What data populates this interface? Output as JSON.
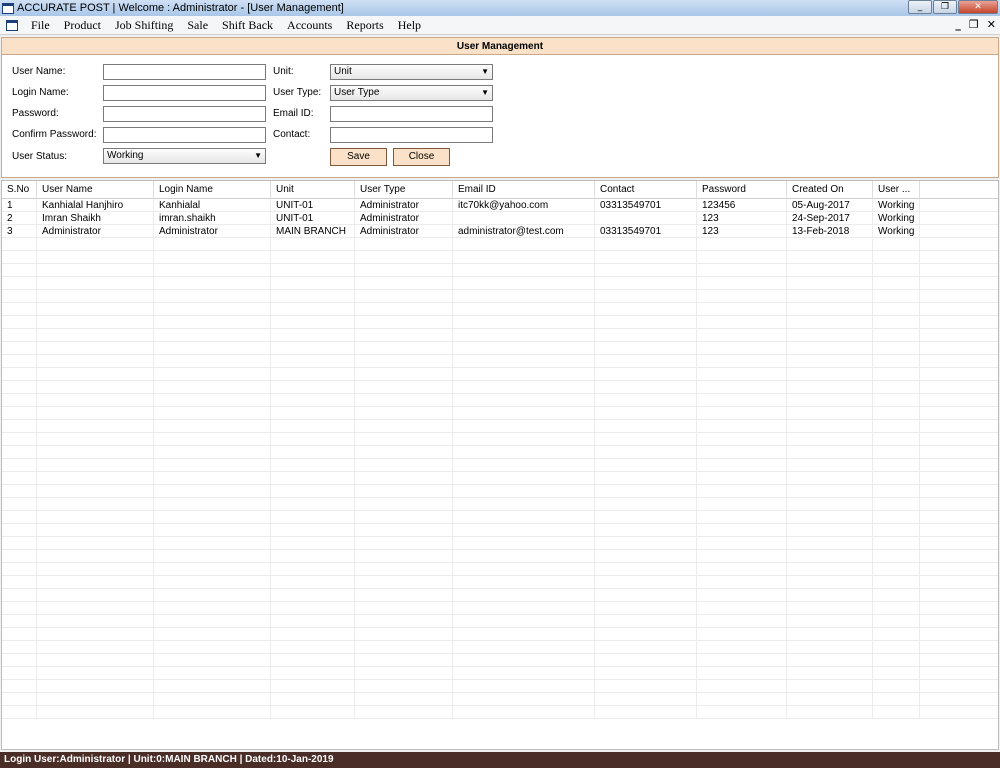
{
  "window": {
    "title": "ACCURATE POST  | Welcome : Administrator - [User Management]",
    "minimize": "_",
    "restore": "❐",
    "close": "✕"
  },
  "menu": {
    "items": [
      "File",
      "Product",
      "Job Shifting",
      "Sale",
      "Shift Back",
      "Accounts",
      "Reports",
      "Help"
    ],
    "mdi_minimize": "_",
    "mdi_restore": "❐",
    "mdi_close": "✕"
  },
  "form": {
    "header": "User Management",
    "labels": {
      "user_name": "User Name:",
      "login_name": "Login Name:",
      "password": "Password:",
      "confirm_password": "Confirm Password:",
      "user_status": "User Status:",
      "unit": "Unit:",
      "user_type": "User Type:",
      "email": "Email ID:",
      "contact": "Contact:"
    },
    "values": {
      "user_name": "",
      "login_name": "",
      "password": "",
      "confirm_password": "",
      "user_status": "Working",
      "unit": "Unit",
      "user_type": "User Type",
      "email": "",
      "contact": ""
    },
    "buttons": {
      "save": "Save",
      "close": "Close"
    }
  },
  "grid": {
    "columns": [
      "S.No",
      "User Name",
      "Login Name",
      "Unit",
      "User Type",
      "Email ID",
      "Contact",
      "Password",
      "Created On",
      "User ..."
    ],
    "rows": [
      [
        "1",
        "Kanhialal Hanjhiro",
        "Kanhialal",
        "UNIT-01",
        "Administrator",
        "itc70kk@yahoo.com",
        "03313549701",
        "123456",
        "05-Aug-2017",
        "Working"
      ],
      [
        "2",
        "Imran Shaikh",
        "imran.shaikh",
        "UNIT-01",
        "Administrator",
        "",
        "",
        "123",
        "24-Sep-2017",
        "Working"
      ],
      [
        "3",
        "Administrator",
        "Administrator",
        "MAIN BRANCH",
        "Administrator",
        "administrator@test.com",
        "03313549701",
        "123",
        "13-Feb-2018",
        "Working"
      ]
    ]
  },
  "status": {
    "text": "Login User:Administrator | Unit:0:MAIN BRANCH | Dated:10-Jan-2019"
  }
}
